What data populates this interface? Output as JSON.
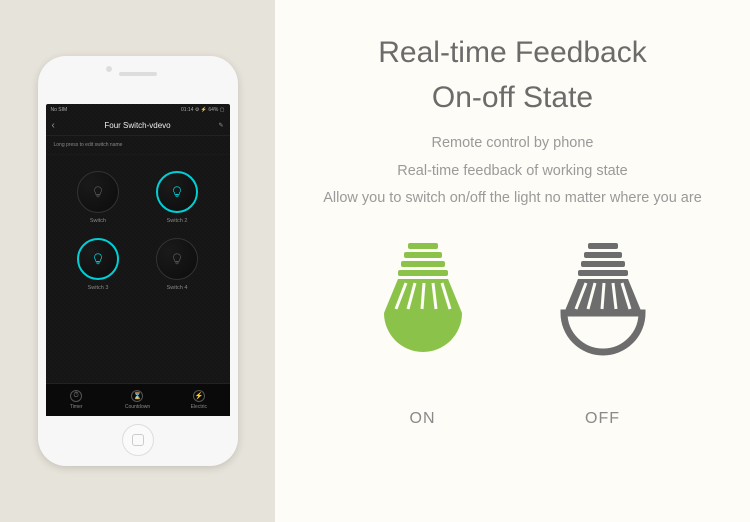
{
  "colors": {
    "on": "#8BC34A",
    "off": "#6d6d6d",
    "accent": "#00cfd6"
  },
  "phone": {
    "status": {
      "left": "No SIM",
      "right": "01:14  ⚙ ⚡ 64% ▢"
    },
    "title": "Four Switch-vdevo",
    "hint": "Long press to edit switch name",
    "edit_icon": "✎",
    "switches": [
      {
        "label": "Switch",
        "on": false
      },
      {
        "label": "Switch 2",
        "on": true
      },
      {
        "label": "Switch 3",
        "on": true
      },
      {
        "label": "Switch 4",
        "on": false
      }
    ],
    "tabs": [
      {
        "icon": "⏱",
        "label": "Timer"
      },
      {
        "icon": "⌛",
        "label": "Countdown"
      },
      {
        "icon": "⚡",
        "label": "Electric"
      }
    ]
  },
  "headline1": "Real-time Feedback",
  "headline2": "On-off State",
  "sub1": "Remote control by phone",
  "sub2": "Real-time feedback of working state",
  "sub3": "Allow you to switch on/off the light no matter where you are",
  "bulbs": {
    "on_label": "ON",
    "off_label": "OFF"
  }
}
